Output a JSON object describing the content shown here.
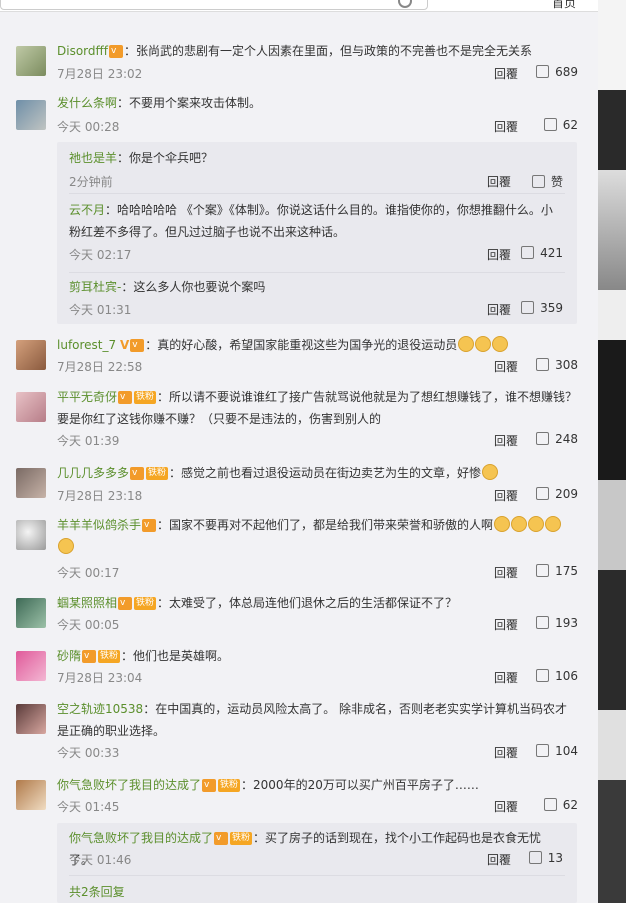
{
  "header": {
    "home_label": "首页"
  },
  "comments": [
    {
      "name": "Disordfff",
      "text": "：张尚武的悲剧有一定个人因素在里面，但与政策的不完善也不是完全无关系",
      "time": "7月28日 23:02",
      "reply": "回覆",
      "likes": "689"
    },
    {
      "name": "发什么条啊",
      "text": "：不要用个案来攻击体制。",
      "time": "今天 00:28",
      "reply": "回覆",
      "likes": "62"
    },
    {
      "name": "luforest_7",
      "text": "：真的好心酸，希望国家能重视这些为国争光的退役运动员",
      "time": "7月28日 22:58",
      "reply": "回覆",
      "likes": "308"
    },
    {
      "name": "平平无奇伢",
      "badge": "铁粉",
      "text": "：所以请不要说谁谁红了接广告就骂说他就是为了想红想赚钱了，谁不想赚钱？要是你红了这钱你赚不赚？（只要不是违法的，伤害到别人的",
      "time": "今天 01:39",
      "reply": "回覆",
      "likes": "248"
    },
    {
      "name": "几几几多多多",
      "badge": "铁粉",
      "text": "：感觉之前也看过退役运动员在街边卖艺为生的文章，好惨",
      "time": "7月28日 23:18",
      "reply": "回覆",
      "likes": "209"
    },
    {
      "name": "羊羊羊似鸽杀手",
      "text": "：国家不要再对不起他们了，都是给我们带来荣誉和骄傲的人啊",
      "time": "今天 00:17",
      "reply": "回覆",
      "likes": "175"
    },
    {
      "name": "蝈某照照相",
      "badge": "铁粉",
      "text": "：太难受了，体总局连他们退休之后的生活都保证不了？",
      "time": "今天 00:05",
      "reply": "回覆",
      "likes": "193"
    },
    {
      "name": "砂隋",
      "badge": "铁粉",
      "text": "：他们也是英雄啊。",
      "time": "7月28日 23:04",
      "reply": "回覆",
      "likes": "106"
    },
    {
      "name": "空之轨迹10538",
      "text": "：在中国真的，运动员风险太高了。 除非成名，否则老老实实学计算机当码农才是正确的职业选择。",
      "time": "今天 00:33",
      "reply": "回覆",
      "likes": "104"
    },
    {
      "name": "你气急败坏了我目的达成了",
      "badge": "铁粉",
      "text": "：2000年的20万可以买广州百平房子了……",
      "time": "今天 01:45",
      "reply": "回覆",
      "likes": "62"
    }
  ],
  "replies_a": [
    {
      "name": "祂也是羊",
      "text": "：你是个伞兵吧？",
      "time": "2分钟前",
      "reply": "回覆",
      "likes": "赞"
    },
    {
      "name": "云不月",
      "text": "：哈哈哈哈哈 《个案》《体制》。你说这话什么目的。谁指使你的，你想推翻什么。小粉红差不多得了。但凡过过脑子也说不出来这种话。",
      "time": "今天 02:17",
      "reply": "回覆",
      "likes": "421"
    },
    {
      "name": "剪耳杜宾-",
      "text": "：这么多人你也要说个案吗",
      "time": "今天 01:31",
      "reply": "回覆",
      "likes": "359"
    }
  ],
  "replies_b": [
    {
      "name": "你气急败坏了我目的达成了",
      "badge": "铁粉",
      "text": "：买了房子的话到现在，找个小工作起码也是衣食无忧了。",
      "time": "今天 01:46",
      "reply": "回覆",
      "likes": "13"
    }
  ],
  "more_replies": "共2条回复",
  "colors": {
    "name": "#5b8f2c",
    "accent": "#eb7350",
    "badge": "#f5a623"
  }
}
